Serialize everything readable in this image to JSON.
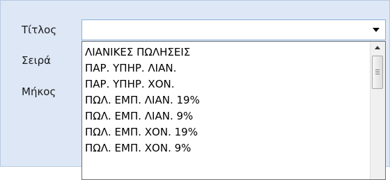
{
  "form": {
    "title_label": "Τίτλος",
    "series_label": "Σειρά",
    "length_label": "Μήκος",
    "title_value": ""
  },
  "dropdown": {
    "items": [
      "ΛΙΑΝΙΚΕΣ ΠΩΛΗΣΕΙΣ",
      "ΠΑΡ. ΥΠΗΡ. ΛΙΑΝ.",
      "ΠΑΡ. ΥΠΗΡ. ΧΟΝ.",
      "ΠΩΛ. ΕΜΠ. ΛΙΑΝ. 19%",
      "ΠΩΛ. ΕΜΠ. ΛΙΑΝ. 9%",
      "ΠΩΛ. ΕΜΠ. ΧΟΝ. 19%",
      "ΠΩΛ. ΕΜΠ. ΧΟΝ. 9%"
    ]
  },
  "colors": {
    "panel_bg": "#dde7f6",
    "combo_border": "#8eaedc",
    "dropdown_border": "#6f6f6f"
  },
  "icons": {
    "combo_arrow": "chevron-down-icon",
    "scroll_up": "scroll-up-arrow-icon"
  }
}
